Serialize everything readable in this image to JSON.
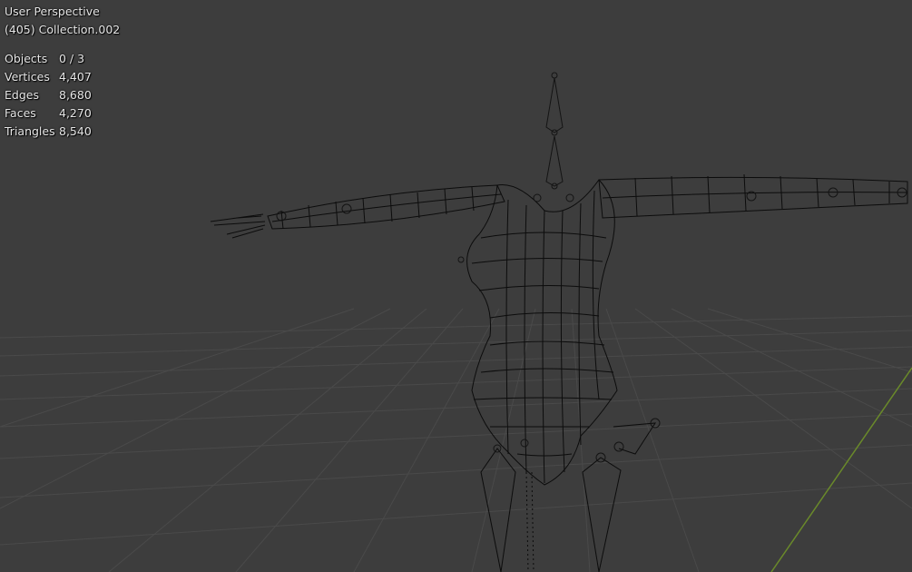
{
  "viewport": {
    "view_name": "User Perspective",
    "collection": "(405) Collection.002"
  },
  "stats": [
    {
      "label": "Objects",
      "value": "0 / 3"
    },
    {
      "label": "Vertices",
      "value": "4,407"
    },
    {
      "label": "Edges",
      "value": "8,680"
    },
    {
      "label": "Faces",
      "value": "4,270"
    },
    {
      "label": "Triangles",
      "value": "8,540"
    }
  ],
  "colors": {
    "background": "#3d3d3d",
    "grid": "#4a4a4a",
    "axis_y": "#6a8a2a",
    "wire": "#0c0c0c",
    "bone": "#141414"
  }
}
